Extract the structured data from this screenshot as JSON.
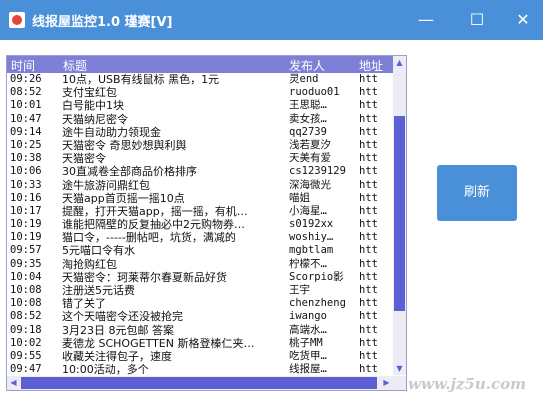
{
  "window": {
    "title": "线报屋监控1.0 瑾赛[V]",
    "minimize_glyph": "—",
    "maximize_glyph": "☐",
    "close_glyph": "✕"
  },
  "list": {
    "columns": [
      "时间",
      "标题",
      "发布人",
      "地址"
    ],
    "rows": [
      {
        "time": "09:26",
        "title": "10点，USB有线鼠标 黑色，1元",
        "publisher": "灵end",
        "addr": "htt"
      },
      {
        "time": "08:52",
        "title": "支付宝红包",
        "publisher": "ruoduo01",
        "addr": "htt"
      },
      {
        "time": "10:01",
        "title": "白号能中1块",
        "publisher": "王思聪…",
        "addr": "htt"
      },
      {
        "time": "10:47",
        "title": "天猫纳尼密令",
        "publisher": "卖女孩…",
        "addr": "htt"
      },
      {
        "time": "09:14",
        "title": "途牛自动助力领现金",
        "publisher": "qq2739",
        "addr": "htt"
      },
      {
        "time": "10:25",
        "title": "天猫密令 奇思妙想舆利舆",
        "publisher": "浅若夏汐",
        "addr": "htt"
      },
      {
        "time": "10:38",
        "title": "天猫密令",
        "publisher": "天美有爱",
        "addr": "htt"
      },
      {
        "time": "10:06",
        "title": "30直减卷全部商品价格排序",
        "publisher": "cs1239129",
        "addr": "htt"
      },
      {
        "time": "10:33",
        "title": "途牛旅游问鼎红包",
        "publisher": "深海微光",
        "addr": "htt"
      },
      {
        "time": "10:16",
        "title": "天猫app首页摇一摇10点",
        "publisher": "喵姐",
        "addr": "htt"
      },
      {
        "time": "10:17",
        "title": "提醒，打开天猫app，摇一摇，有机…",
        "publisher": "小海星…",
        "addr": "htt"
      },
      {
        "time": "10:19",
        "title": "谁能把隔壁的反复抽必中2元购物券…",
        "publisher": "s0192xx",
        "addr": "htt"
      },
      {
        "time": "10:19",
        "title": "猫口令，-----删帖吧，坑货，满减的",
        "publisher": "woshiy…",
        "addr": "htt"
      },
      {
        "time": "09:57",
        "title": "5元喵口令有水",
        "publisher": "mgbtlam",
        "addr": "htt"
      },
      {
        "time": "09:35",
        "title": "淘抢购红包",
        "publisher": "柠檬不…",
        "addr": "htt"
      },
      {
        "time": "10:04",
        "title": "天猫密令：珂莱蒂尔春夏新品好货",
        "publisher": "Scorpio影",
        "addr": "htt"
      },
      {
        "time": "10:08",
        "title": "注册送5元话费",
        "publisher": "王宇",
        "addr": "htt"
      },
      {
        "time": "10:08",
        "title": "错了关了",
        "publisher": "chenzheng",
        "addr": "htt"
      },
      {
        "time": "08:52",
        "title": "这个天喵密令还没被抢完",
        "publisher": "iwango",
        "addr": "htt"
      },
      {
        "time": "09:18",
        "title": "3月23日 8元包邮 答案",
        "publisher": "高端水…",
        "addr": "htt"
      },
      {
        "time": "10:02",
        "title": "麦德龙 SCHOGETTEN 斯格登榛仁夹…",
        "publisher": "桃子MM",
        "addr": "htt"
      },
      {
        "time": "09:55",
        "title": "收藏关注得包子，速度",
        "publisher": "吃货甲…",
        "addr": "htt"
      },
      {
        "time": "09:47",
        "title": "10:00活动，多个",
        "publisher": "线报屋…",
        "addr": "htt"
      }
    ]
  },
  "buttons": {
    "refresh": "刷新"
  },
  "watermark": "www.jz5u.com",
  "colors": {
    "titlebar": "#4a90d9",
    "header": "#7d80d6",
    "scroll_thumb": "#5d60d4",
    "button": "#4a90d9"
  }
}
